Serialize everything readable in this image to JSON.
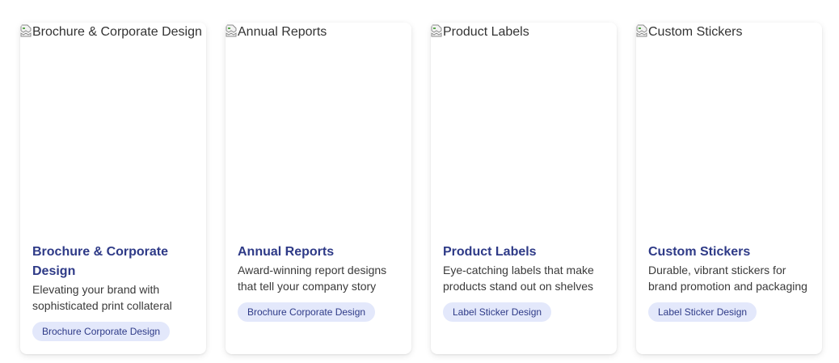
{
  "cards": [
    {
      "image_alt": "Brochure & Corporate Design",
      "title": "Brochure & Corporate Design",
      "description": "Elevating your brand with sophisticated print collateral",
      "tag": "Brochure Corporate Design"
    },
    {
      "image_alt": "Annual Reports",
      "title": "Annual Reports",
      "description": "Award-winning report designs that tell your company story",
      "tag": "Brochure Corporate Design"
    },
    {
      "image_alt": "Product Labels",
      "title": "Product Labels",
      "description": "Eye-catching labels that make products stand out on shelves",
      "tag": "Label Sticker Design"
    },
    {
      "image_alt": "Custom Stickers",
      "title": "Custom Stickers",
      "description": "Durable, vibrant stickers for brand promotion and packaging",
      "tag": "Label Sticker Design"
    }
  ],
  "colors": {
    "title": "#2e3a87",
    "tag_background": "#e3e8fb",
    "card_background": "#ffffff"
  },
  "icons": {
    "broken_image": "broken-image-icon"
  }
}
